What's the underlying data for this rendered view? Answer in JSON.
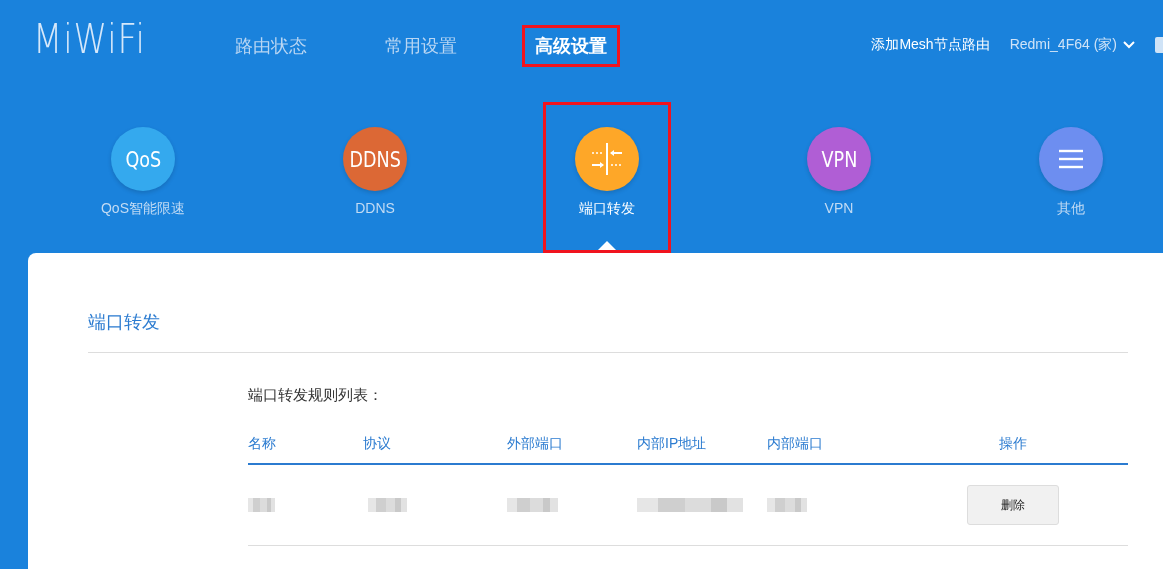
{
  "header": {
    "logo": "MiWiFi",
    "tabs": [
      {
        "label": "路由状态",
        "selected": false,
        "highlighted": false
      },
      {
        "label": "常用设置",
        "selected": false,
        "highlighted": false
      },
      {
        "label": "高级设置",
        "selected": true,
        "highlighted": true
      }
    ],
    "add_mesh": "添加Mesh节点路由",
    "device": "Redmi_4F64 (家)"
  },
  "features": [
    {
      "badge": "QoS",
      "label": "QoS智能限速",
      "color": "#34a9ee",
      "selected": false,
      "highlighted": false,
      "kind": "text"
    },
    {
      "badge": "DDNS",
      "label": "DDNS",
      "color": "#dc6835",
      "selected": false,
      "highlighted": false,
      "kind": "text"
    },
    {
      "label": "端口转发",
      "color": "#fea728",
      "selected": true,
      "highlighted": true,
      "kind": "ports"
    },
    {
      "badge": "VPN",
      "label": "VPN",
      "color": "#b05ed5",
      "selected": false,
      "highlighted": false,
      "kind": "text"
    },
    {
      "label": "其他",
      "color": "#6d8ef0",
      "selected": false,
      "highlighted": false,
      "kind": "menu"
    }
  ],
  "panel": {
    "title": "端口转发",
    "subtitle": "端口转发规则列表：",
    "table": {
      "columns": [
        "名称",
        "协议",
        "外部端口",
        "内部IP地址",
        "内部端口",
        "操作"
      ],
      "rows": [
        {
          "cells": [
            {
              "kind": "redacted"
            },
            {
              "kind": "redacted"
            },
            {
              "kind": "redacted"
            },
            {
              "kind": "redacted"
            },
            {
              "kind": "redacted"
            }
          ],
          "action": "删除"
        }
      ]
    }
  }
}
